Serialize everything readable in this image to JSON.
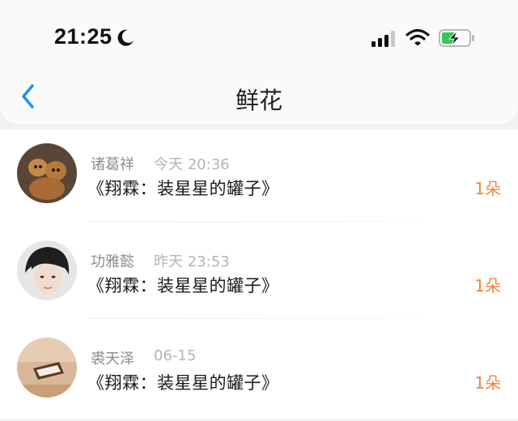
{
  "status_bar": {
    "time": "21:25",
    "icons": [
      "moon-icon",
      "signal-icon",
      "wifi-icon",
      "battery-charging-icon"
    ]
  },
  "nav": {
    "back_icon": "chevron-left-icon",
    "title": "鲜花"
  },
  "colors": {
    "accent": "#1a95f0",
    "count": "#f0823c",
    "battery": "#34c759"
  },
  "items": [
    {
      "name": "诸葛祥",
      "time": "今天 20:36",
      "desc": "《翔霖：装星星的罐子》",
      "count": "1朵"
    },
    {
      "name": "功雅懿",
      "time": "昨天 23:53",
      "desc": "《翔霖：装星星的罐子》",
      "count": "1朵"
    },
    {
      "name": "裘天泽",
      "time": "06-15",
      "desc": "《翔霖：装星星的罐子》",
      "count": "1朵"
    }
  ]
}
